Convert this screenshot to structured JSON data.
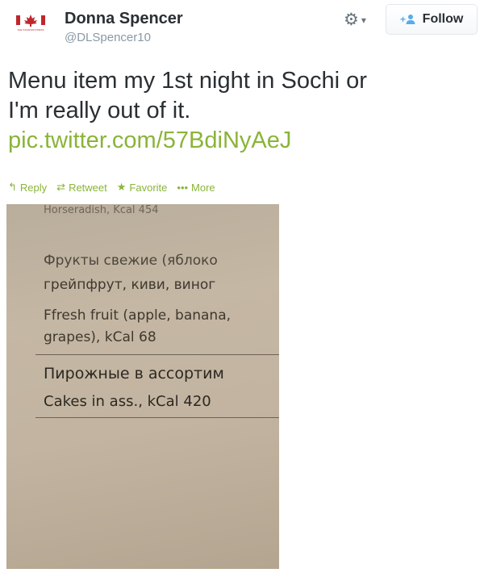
{
  "header": {
    "avatar_caption": "THE CANADIAN PRESS",
    "name": "Donna Spencer",
    "handle": "@DLSpencer10",
    "settings_icon": "gear-icon",
    "follow_label": "Follow"
  },
  "tweet": {
    "text_line1": "Menu item my 1st night in Sochi or",
    "text_line2": "I'm really out of it.",
    "link": "pic.twitter.com/57BdiNyAeJ",
    "link_color": "#8ab439"
  },
  "actions": {
    "reply": "Reply",
    "retweet": "Retweet",
    "favorite": "Favorite",
    "more": "More"
  },
  "photo": {
    "line1": "Horseradish, Kcal 454",
    "line2": "Фрукты свежие (яблоко",
    "line3": "грейпфрут, киви, виног",
    "line4": "Ffresh fruit (apple, banana,",
    "line5": "grapes), kCal 68",
    "line6": "Пирожные в ассортим",
    "line7": "Cakes in ass., kCal 420"
  }
}
